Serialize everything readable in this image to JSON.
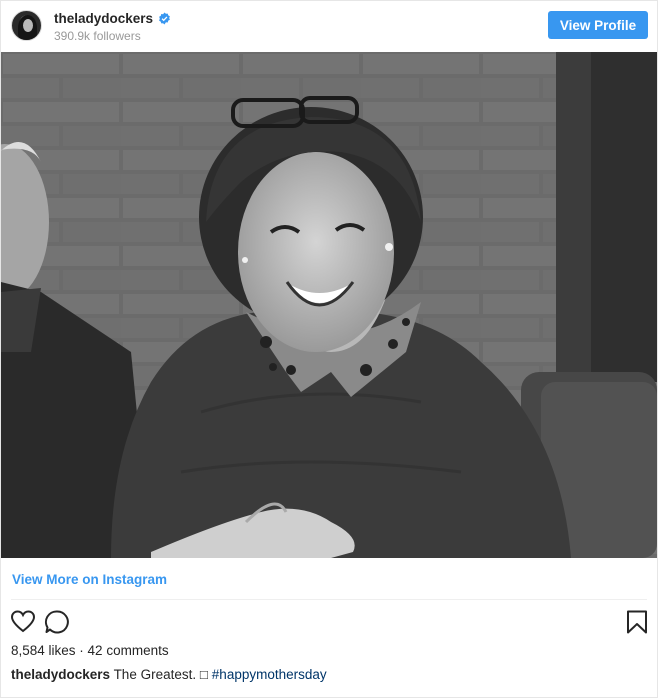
{
  "header": {
    "username": "theladydockers",
    "followers": "390.9k followers",
    "view_profile_label": "View Profile",
    "avatar_icon": "profile-avatar",
    "verified_icon": "verified-badge-icon"
  },
  "photo": {
    "icon": "post-photo"
  },
  "view_more_label": "View More on Instagram",
  "actions": {
    "like_icon": "heart-icon",
    "comment_icon": "comment-icon",
    "save_icon": "bookmark-icon"
  },
  "stats": {
    "likes": "8,584 likes",
    "separator": " · ",
    "comments": "42 comments"
  },
  "caption": {
    "username": "theladydockers",
    "text": "The Greatest.",
    "emoji_placeholder": "□",
    "hashtag": "#happymothersday"
  },
  "colors": {
    "accent": "#3897f0",
    "text": "#262626",
    "muted": "#999999",
    "hashtag": "#003569"
  }
}
